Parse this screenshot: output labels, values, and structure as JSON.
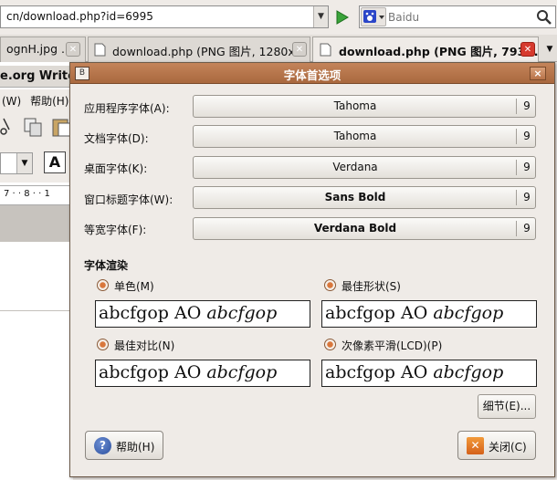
{
  "browser": {
    "url": "cn/download.php?id=6995",
    "search_placeholder": "Baidu",
    "tabs": [
      {
        "label": "ognH.jpg ...",
        "active": false
      },
      {
        "label": "download.php (PNG 图片, 1280x...",
        "active": false
      },
      {
        "label": "download.php (PNG 图片, 793...",
        "active": true
      }
    ]
  },
  "background_app": {
    "title": "e.org Writer",
    "menu": [
      "(W)",
      "帮助(H)"
    ],
    "ruler": "7 · · 8 · · 1"
  },
  "dialog": {
    "title": "字体首选项",
    "fonts": [
      {
        "label": "应用程序字体(A):",
        "font": "Tahoma",
        "size": "9"
      },
      {
        "label": "文档字体(D):",
        "font": "Tahoma",
        "size": "9"
      },
      {
        "label": "桌面字体(K):",
        "font": "Verdana",
        "size": "9"
      },
      {
        "label": "窗口标题字体(W):",
        "font": "Sans Bold",
        "size": "9"
      },
      {
        "label": "等宽字体(F):",
        "font": "Verdana Bold",
        "size": "9"
      }
    ],
    "rendering_title": "字体渲染",
    "rendering_options": [
      {
        "label": "单色(M)",
        "preview_upright": "abcfgop AO ",
        "preview_italic": "abcfgop"
      },
      {
        "label": "最佳形状(S)",
        "preview_upright": "abcfgop AO ",
        "preview_italic": "abcfgop"
      },
      {
        "label": "最佳对比(N)",
        "preview_upright": "abcfgop AO ",
        "preview_italic": "abcfgop"
      },
      {
        "label": "次像素平滑(LCD)(P)",
        "preview_upright": "abcfgop AO ",
        "preview_italic": "abcfgop"
      }
    ],
    "details_button": "细节(E)...",
    "help_button": "帮助(H)",
    "close_button": "关闭(C)"
  }
}
